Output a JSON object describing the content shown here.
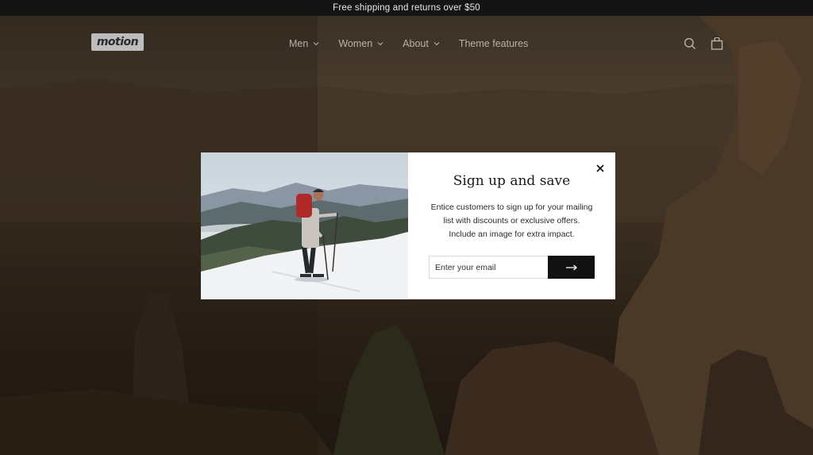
{
  "announcement": {
    "text": "Free shipping and returns over $50"
  },
  "header": {
    "logo_text": "motion",
    "nav": [
      {
        "label": "Men",
        "has_dropdown": true
      },
      {
        "label": "Women",
        "has_dropdown": true
      },
      {
        "label": "About",
        "has_dropdown": true
      },
      {
        "label": "Theme features",
        "has_dropdown": false
      }
    ],
    "icons": [
      "search-icon",
      "cart-icon"
    ]
  },
  "popup": {
    "title": "Sign up and save",
    "body": "Entice customers to sign up for your mailing list with discounts or exclusive offers. Include an image for extra impact.",
    "email_placeholder": "Enter your email",
    "submit_icon": "arrow-right-icon",
    "close_icon": "close-icon"
  },
  "colors": {
    "announcement_bg": "#141414",
    "modal_bg": "#ffffff",
    "submit_bg": "#111111"
  }
}
